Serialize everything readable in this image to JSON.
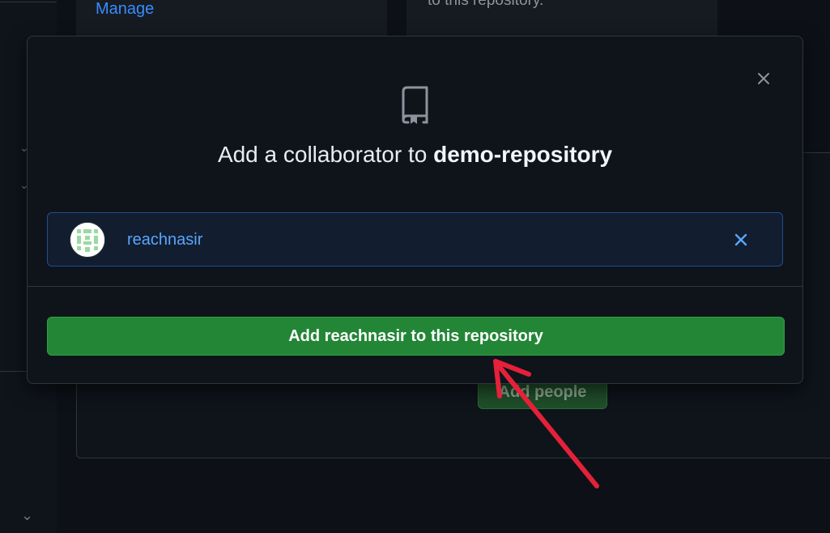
{
  "background": {
    "manage_link": "Manage",
    "card2_text": "to this repository.",
    "add_people_label": "Add people"
  },
  "modal": {
    "title_prefix": "Add a collaborator to ",
    "repo_name": "demo-repository",
    "selected_user": {
      "username": "reachnasir"
    },
    "add_button_label": "Add reachnasir to this repository",
    "close_icon": "close-icon",
    "repo_icon": "repo-icon"
  },
  "colors": {
    "accent_link": "#58a6ff",
    "primary_button": "#238636",
    "annotation": "#e5213a"
  }
}
